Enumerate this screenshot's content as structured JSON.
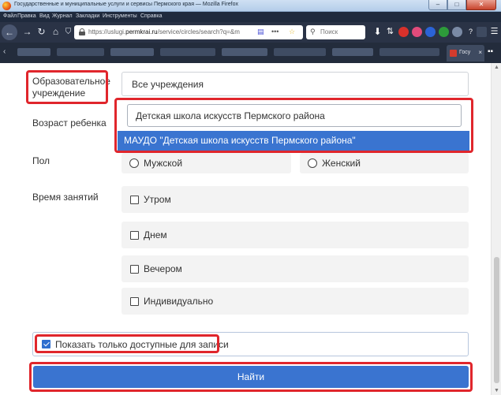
{
  "window": {
    "title": "Государственные и муниципальные услуги и сервисы Пермского края — Mozilla Firefox",
    "minimize_label": "–",
    "maximize_label": "□",
    "close_label": "✕"
  },
  "menubar": {
    "items": [
      "Файл",
      "Правка",
      "Вид",
      "Журнал",
      "Закладки",
      "Инструменты",
      "Справка"
    ]
  },
  "browser": {
    "url_prefix": "https://uslugi.",
    "url_domain": "permkrai.ru",
    "url_suffix": "/service/circles/search?q=&m",
    "search_placeholder": "Поиск",
    "tab_title": "Госу",
    "tab_close": "×"
  },
  "form": {
    "institution_label": "Образовательное учреждение",
    "institution_value": "Все учреждения",
    "age_label": "Возраст ребенка",
    "search_query": "Детская школа искусств Пермского района",
    "suggestion": "МАУДО \"Детская школа искусств Пермского района\"",
    "gender_label": "Пол",
    "gender_options": [
      "Мужской",
      "Женский"
    ],
    "time_label": "Время занятий",
    "time_options": [
      "Утром",
      "Днем",
      "Вечером",
      "Индивидуально"
    ],
    "only_available_label": "Показать только доступные для записи",
    "only_available_checked": true,
    "submit_label": "Найти"
  },
  "colors": {
    "accent": "#3a74d0",
    "highlight": "#e0262c",
    "browser_chrome": "#2a3346"
  }
}
